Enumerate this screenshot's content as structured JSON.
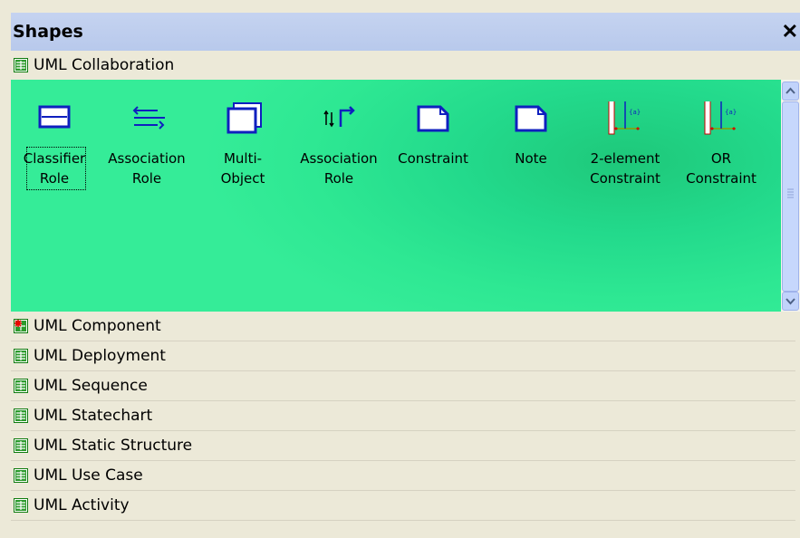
{
  "header": {
    "title": "Shapes",
    "close_glyph": "✕"
  },
  "stencils_top": [
    {
      "label": "UML Collaboration",
      "icon": "stencil-green-icon"
    }
  ],
  "shapes": [
    {
      "label": "Classifier\nRole",
      "icon": "classifier-role-icon"
    },
    {
      "label": "Association\nRole",
      "icon": "association-role-icon"
    },
    {
      "label": "Multi-Object",
      "icon": "multi-object-icon"
    },
    {
      "label": "Association\nRole",
      "icon": "association-role-2-icon"
    },
    {
      "label": "Constraint",
      "icon": "constraint-icon"
    },
    {
      "label": "Note",
      "icon": "note-icon"
    },
    {
      "label": "2-element\nConstraint",
      "icon": "two-element-constraint-icon"
    },
    {
      "label": "OR\nConstraint",
      "icon": "or-constraint-icon"
    }
  ],
  "stencils_bottom": [
    {
      "label": "UML Component",
      "icon": "stencil-red-icon"
    },
    {
      "label": "UML Deployment",
      "icon": "stencil-green-icon"
    },
    {
      "label": "UML Sequence",
      "icon": "stencil-green-icon"
    },
    {
      "label": "UML Statechart",
      "icon": "stencil-green-icon"
    },
    {
      "label": "UML Static Structure",
      "icon": "stencil-green-icon"
    },
    {
      "label": "UML Use Case",
      "icon": "stencil-green-icon"
    },
    {
      "label": "UML Activity",
      "icon": "stencil-green-icon"
    }
  ],
  "colors": {
    "panel_green": "#2ee893",
    "header_blue": "#c5d3f0",
    "stencil_bg": "#ece9d8"
  }
}
